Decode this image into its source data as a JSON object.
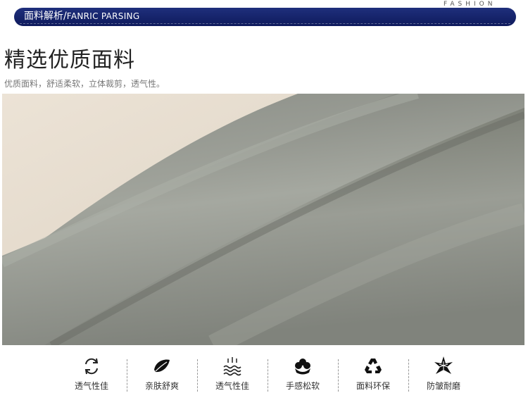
{
  "header": {
    "fashion_label": "FASHION",
    "banner_cn": "面料解析",
    "banner_sep": "/",
    "banner_en": "FANRIC PARSING",
    "banner_color": "#152469"
  },
  "section": {
    "title": "精选优质面料",
    "subtitle": "优质面料，舒适柔软，立体裁剪，透气性。"
  },
  "fabric_image": {
    "base_color": "#8d908a",
    "highlight_color": "#a3a69f",
    "shadow_color": "#6e716b",
    "background_color": "#e7ddd0"
  },
  "features": [
    {
      "icon": "recycle-arrows-icon",
      "label": "透气性佳"
    },
    {
      "icon": "leaf-icon",
      "label": "亲肤舒爽"
    },
    {
      "icon": "steam-waves-icon",
      "label": "透气性佳"
    },
    {
      "icon": "cotton-flower-icon",
      "label": "手感松软"
    },
    {
      "icon": "recycle-triangle-icon",
      "label": "面料环保"
    },
    {
      "icon": "star-burst-icon",
      "label": "防皱耐磨"
    }
  ]
}
